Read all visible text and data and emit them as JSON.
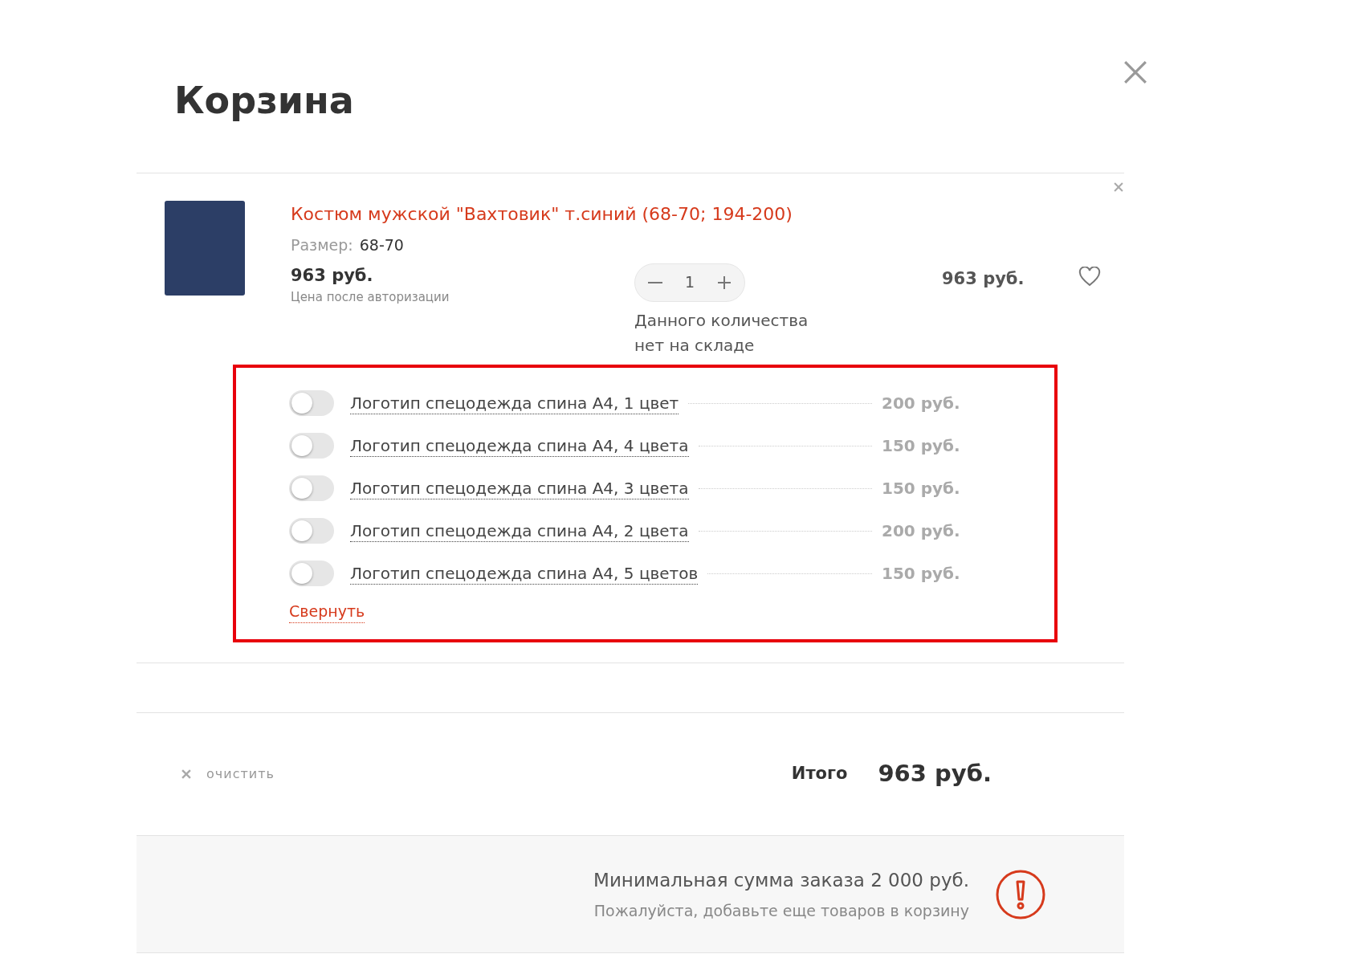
{
  "title": "Корзина",
  "item": {
    "name": "Костюм мужской \"Вахтовик\" т.синий (68-70; 194-200)",
    "size_label": "Размер:",
    "size": "68-70",
    "price": "963 руб.",
    "price_note": "Цена после авторизации",
    "quantity": "1",
    "stock_note": "Данного количества нет на складе",
    "total": "963 руб.",
    "options": [
      {
        "label": "Логотип спецодежда спина А4, 1 цвет",
        "price": "200 руб.",
        "on": false
      },
      {
        "label": "Логотип спецодежда спина А4, 4 цвета",
        "price": "150 руб.",
        "on": false
      },
      {
        "label": "Логотип спецодежда спина А4, 3 цвета",
        "price": "150 руб.",
        "on": false
      },
      {
        "label": "Логотип спецодежда спина А4, 2 цвета",
        "price": "200 руб.",
        "on": false
      },
      {
        "label": "Логотип спецодежда спина А4, 5 цветов",
        "price": "150 руб.",
        "on": false
      }
    ],
    "collapse_link": "Свернуть"
  },
  "clear_label": "очистить",
  "total_label": "Итого",
  "total": "963 руб.",
  "notice": {
    "title": "Минимальная сумма заказа 2 000 руб.",
    "text": "Пожалуйста, добавьте еще товаров в корзину"
  }
}
